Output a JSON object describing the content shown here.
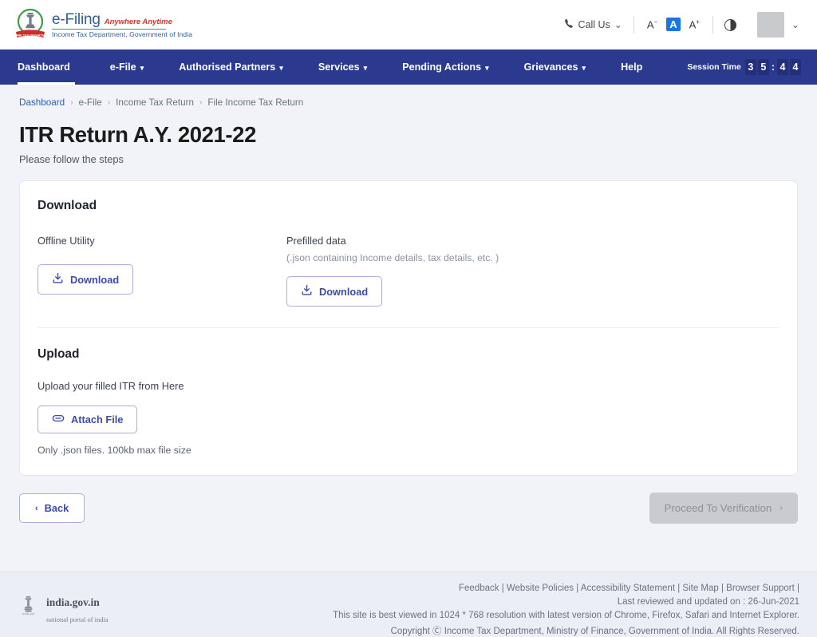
{
  "header": {
    "logo": {
      "title": "e-Filing",
      "tagline": "Anywhere Anytime",
      "department": "Income Tax Department, Government of India",
      "emblem_icon": "india-emblem-icon"
    },
    "call_us": {
      "label": "Call Us",
      "icon": "phone-icon",
      "caret": "⌄"
    },
    "font_controls": {
      "decrease": "A",
      "decrease_sign": "−",
      "normal": "A",
      "increase": "A",
      "increase_sign": "+"
    },
    "contrast_icon": "contrast-icon",
    "avatar_icon": "avatar-icon",
    "avatar_caret": "⌄"
  },
  "nav": {
    "items": [
      {
        "label": "Dashboard",
        "has_caret": false,
        "active": true
      },
      {
        "label": "e-File",
        "has_caret": true,
        "active": false
      },
      {
        "label": "Authorised Partners",
        "has_caret": true,
        "active": false
      },
      {
        "label": "Services",
        "has_caret": true,
        "active": false
      },
      {
        "label": "Pending Actions",
        "has_caret": true,
        "active": false
      },
      {
        "label": "Grievances",
        "has_caret": true,
        "active": false
      },
      {
        "label": "Help",
        "has_caret": false,
        "active": false
      }
    ],
    "session": {
      "label": "Session Time",
      "digits": [
        "3",
        "5",
        "4",
        "4"
      ],
      "separator": ":",
      "value": "35:44"
    }
  },
  "breadcrumb": {
    "items": [
      "Dashboard",
      "e-File",
      "Income Tax Return",
      "File Income Tax Return"
    ],
    "separator": "›"
  },
  "page": {
    "title": "ITR Return A.Y. 2021-22",
    "subtitle": "Please follow the steps"
  },
  "download": {
    "section_title": "Download",
    "offline_utility": {
      "label": "Offline Utility",
      "button": "Download",
      "icon": "download-icon"
    },
    "prefilled": {
      "label": "Prefilled data",
      "hint": "(.json containing Income details, tax details, etc. )",
      "button": "Download",
      "icon": "download-icon"
    }
  },
  "upload": {
    "section_title": "Upload",
    "label": "Upload your filled ITR from Here",
    "button": "Attach File",
    "icon": "paperclip-icon",
    "note": "Only .json files. 100kb max file size"
  },
  "actions": {
    "back": {
      "label": "Back",
      "chevron": "‹"
    },
    "proceed": {
      "label": "Proceed To Verification",
      "chevron": "›",
      "disabled": true
    }
  },
  "footer": {
    "gov_logo": {
      "title": "india.gov.in",
      "subtitle": "national portal of india",
      "icon": "ashoka-emblem-icon"
    },
    "links": [
      "Feedback",
      "Website Policies",
      "Accessibility Statement",
      "Site Map",
      "Browser Support"
    ],
    "links_text": "Feedback | Website Policies | Accessibility Statement | Site Map | Browser Support |",
    "last_reviewed": "Last reviewed and updated on : 26-Jun-2021",
    "best_viewed": "This site is best viewed in 1024 * 768 resolution with latest version of Chrome, Firefox, Safari and Internet Explorer.",
    "copyright": "Copyright Ⓒ Income Tax Department, Ministry of Finance, Government of India. All Rights Reserved."
  },
  "colors": {
    "nav_blue": "#2b3a8f",
    "brand_blue": "#2b5fa8",
    "accent_red": "#e03127",
    "accent_green": "#3c9e4a",
    "button_indigo": "#3d4ba8",
    "page_bg": "#f1f3f9",
    "highlight_blue": "#1a73e8"
  }
}
